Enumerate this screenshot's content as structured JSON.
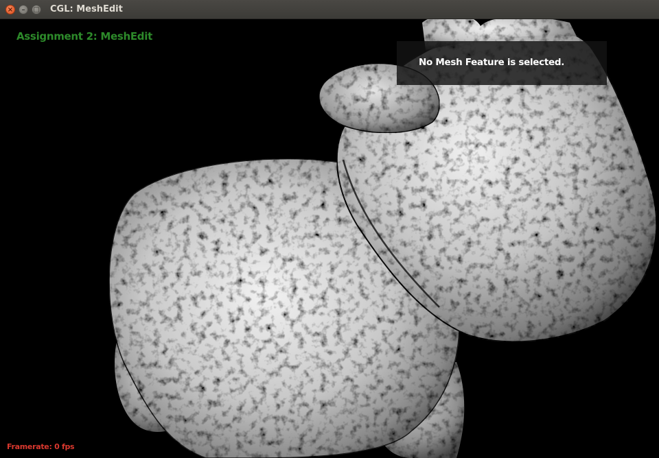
{
  "window": {
    "title": "CGL: MeshEdit",
    "close_glyph": "×",
    "minimize_glyph": "–",
    "maximize_glyph": "□"
  },
  "overlay": {
    "assignment_title": "Assignment 2: MeshEdit",
    "selection_info": "No Mesh Feature is selected.",
    "framerate": "Framerate: 0 fps"
  },
  "colors": {
    "title_green": "#2d8a2a",
    "framerate_red": "#d9382e",
    "background": "#000000"
  },
  "icons": {
    "close": "close-icon",
    "minimize": "minimize-icon",
    "maximize": "maximize-icon"
  }
}
